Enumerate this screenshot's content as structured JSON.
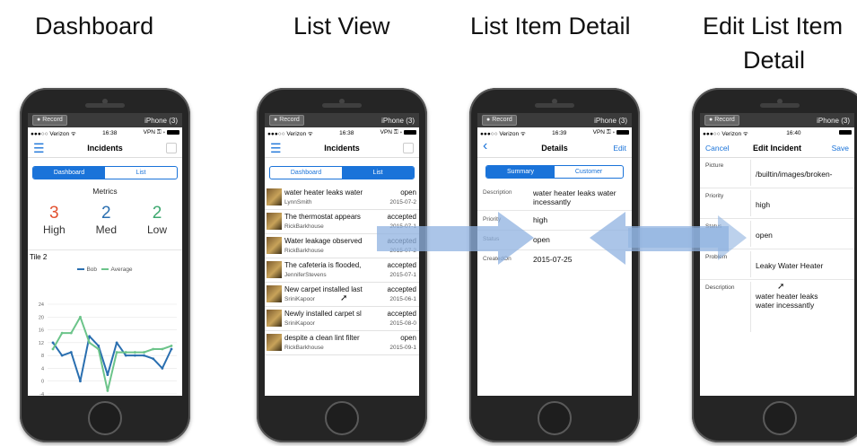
{
  "headings": {
    "dashboard": "Dashboard",
    "list_view": "List View",
    "list_item_detail": "List Item Detail",
    "edit_line1": "Edit List Item",
    "edit_line2": "Detail"
  },
  "recorder": {
    "record_label": "Record",
    "device": "iPhone (3)"
  },
  "phones": {
    "dashboard": {
      "status": {
        "carrier": "●●●○○ Verizon ᯤ",
        "time": "16:38",
        "right": "VPN ⚿ ∗"
      },
      "title": "Incidents",
      "tabs": [
        "Dashboard",
        "List"
      ],
      "metrics_title": "Metrics",
      "metrics": [
        {
          "value": "3",
          "label": "High",
          "color": "#e2502f"
        },
        {
          "value": "2",
          "label": "Med",
          "color": "#2a6fb0"
        },
        {
          "value": "2",
          "label": "Low",
          "color": "#3da86f"
        }
      ],
      "tile_title": "Tile 2",
      "legend": [
        "Bob",
        "Average"
      ]
    },
    "list": {
      "status": {
        "carrier": "●●●○○ Verizon ᯤ",
        "time": "16:38",
        "right": "VPN ⚿ ∗"
      },
      "title": "Incidents",
      "tabs": [
        "Dashboard",
        "List"
      ],
      "rows": [
        {
          "title": "water heater leaks water",
          "user": "LynnSmith",
          "status": "open",
          "date": "2015-07-2"
        },
        {
          "title": "The thermostat appears",
          "user": "RickBarkhouse",
          "status": "accepted",
          "date": "2015-07-1"
        },
        {
          "title": "Water leakage observed",
          "user": "RickBarkhouse",
          "status": "accepted",
          "date": "2015-07-2"
        },
        {
          "title": "The cafeteria is flooded,",
          "user": "JenniferStevens",
          "status": "accepted",
          "date": "2015-07-1"
        },
        {
          "title": "New carpet installed last",
          "user": "SriniKapoor",
          "status": "accepted",
          "date": "2015-06-1"
        },
        {
          "title": "Newly installed carpet sl",
          "user": "SriniKapoor",
          "status": "accepted",
          "date": "2015-08-0"
        },
        {
          "title": "despite a clean lint filter",
          "user": "RickBarkhouse",
          "status": "open",
          "date": "2015-09-1"
        }
      ]
    },
    "detail": {
      "status": {
        "carrier": "●●●○○ Verizon ᯤ",
        "time": "16:39",
        "right": "VPN ⚿ ∗"
      },
      "back": "‹",
      "title": "Details",
      "edit": "Edit",
      "tabs": [
        "Summary",
        "Customer"
      ],
      "fields": [
        {
          "key": "Description",
          "value": "water heater leaks water incessantly"
        },
        {
          "key": "Priority",
          "value": "high"
        },
        {
          "key": "Status",
          "value": "open"
        },
        {
          "key": "CreatedOn",
          "value": "2015-07-25"
        }
      ]
    },
    "edit": {
      "status": {
        "carrier": "●●●○○ Verizon ᯤ",
        "time": "16:40",
        "right": "VPN ⚿ ∗"
      },
      "cancel": "Cancel",
      "title": "Edit Incident",
      "save": "Save",
      "fields": [
        {
          "key": "Picture",
          "value": "/builtin/images/broken-"
        },
        {
          "key": "Priority",
          "value": "high"
        },
        {
          "key": "Status",
          "value": "open"
        },
        {
          "key": "Problem",
          "value": "Leaky Water Heater"
        },
        {
          "key": "Description",
          "value": "water heater leaks water incessantly"
        }
      ]
    }
  },
  "chart_data": {
    "type": "line",
    "title": "Tile 2",
    "ylim": [
      -4,
      24
    ],
    "yticks": [
      "24",
      "20",
      "16",
      "12",
      "8",
      "4",
      "0",
      "-4"
    ],
    "series": [
      {
        "name": "Bob",
        "color": "#2a6fb0",
        "values": [
          12,
          8,
          9,
          0,
          14,
          11,
          2,
          12,
          8,
          8,
          8,
          7,
          4,
          10
        ]
      },
      {
        "name": "Average",
        "color": "#6cc48a",
        "values": [
          10,
          15,
          15,
          20,
          12,
          10,
          -3,
          9,
          9,
          9,
          9,
          10,
          10,
          11
        ]
      }
    ]
  },
  "colors": {
    "accent": "#1a73d9",
    "arrow": "#8fb2e0"
  }
}
